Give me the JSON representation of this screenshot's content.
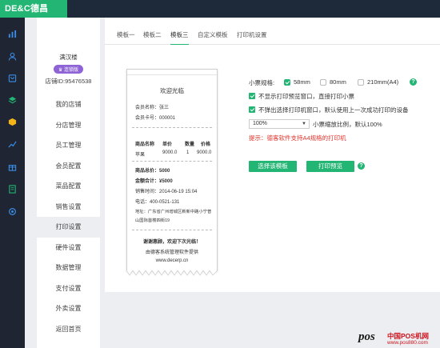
{
  "app": {
    "brand": "DE&C德昌"
  },
  "rail": [
    "chart-icon",
    "user-icon",
    "bag-icon",
    "layers-icon",
    "box-icon",
    "trend-icon",
    "gift-icon",
    "doc-icon",
    "settings-icon"
  ],
  "profile": {
    "store_name": "满汉楼",
    "badge": "连锁版",
    "store_id": "店铺ID:95476538"
  },
  "menu": [
    {
      "label": "我的店铺"
    },
    {
      "label": "分店管理"
    },
    {
      "label": "员工管理"
    },
    {
      "label": "会员配置"
    },
    {
      "label": "菜品配置"
    },
    {
      "label": "销售设置"
    },
    {
      "label": "打印设置",
      "active": true
    },
    {
      "label": "硬件设置"
    },
    {
      "label": "数据管理"
    },
    {
      "label": "支付设置"
    },
    {
      "label": "外卖设置"
    },
    {
      "label": "返回首页"
    }
  ],
  "tabs": [
    {
      "label": "模板一"
    },
    {
      "label": "模板二"
    },
    {
      "label": "模板三",
      "active": true
    },
    {
      "label": "自定义模板"
    },
    {
      "label": "打印机设置"
    }
  ],
  "receipt": {
    "title": "欢迎光临",
    "member_name": "会员名称：张三",
    "member_card": "会员卡号：000001",
    "headers": [
      "商品名称",
      "单价",
      "数量",
      "价格"
    ],
    "item": [
      "苹果",
      "9000.0",
      "1",
      "9000.0"
    ],
    "goods_total": "商品总价：5000",
    "amount_total": "金额合计：¥5000",
    "sale_time": "销售时间：2014-06-19 15:04",
    "phone": "电话：400-0521-131",
    "address_1": "地址：广东省广州增城区新新中路小宁普",
    "address_2": "山国际首楼四街19",
    "thanks": "谢谢惠顾，欢迎下次光临！",
    "provider": "由德客系统管理软件提供",
    "website": "www.decerp.cn"
  },
  "settings": {
    "paper_label": "小票规格:",
    "paper_options": [
      {
        "label": "58mm",
        "selected": true
      },
      {
        "label": "80mm",
        "selected": false
      },
      {
        "label": "210mm(A4)",
        "selected": false
      }
    ],
    "check_1": "不显示打印预览窗口，直接打印小票",
    "check_2": "不弹出选择打印机窗口，默认使用上一次成功打印的设备",
    "zoom_value": "100%",
    "zoom_label": "小票缩放比例，默认100%",
    "tip": "提示：德客软件支持A4规格的打印机",
    "select_template_btn": "选择该模板",
    "print_preview_btn": "打印预览",
    "accent_color": "#22b573"
  },
  "watermark": {
    "pos": "pos",
    "cn": "中国POS机网",
    "url": "www.pos880.com"
  }
}
